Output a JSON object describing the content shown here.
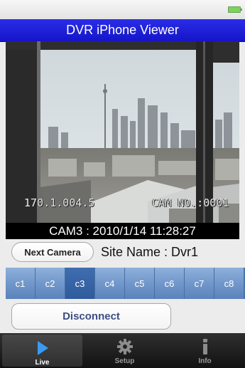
{
  "header": {
    "title": "DVR iPhone Viewer"
  },
  "video": {
    "overlay_left": "170.1.004.5",
    "overlay_right": "CAM NO.:0001",
    "timestamp": "CAM3 : 2010/1/14 11:28:27"
  },
  "controls": {
    "next_camera_label": "Next Camera",
    "site_name": "Site Name :  Dvr1",
    "disconnect_label": "Disconnect"
  },
  "cameras": {
    "selected": "c3",
    "items": [
      "c1",
      "c2",
      "c3",
      "c4",
      "c5",
      "c6",
      "c7",
      "c8"
    ]
  },
  "tabs": [
    {
      "label": "Live",
      "icon": "play-icon",
      "selected": true
    },
    {
      "label": "Setup",
      "icon": "gear-icon",
      "selected": false
    },
    {
      "label": "Info",
      "icon": "info-icon",
      "selected": false
    }
  ],
  "colors": {
    "title_bar": "#1e1ed6",
    "selected_camera": "#3566a8",
    "tab_bar": "#1f1f1f"
  }
}
